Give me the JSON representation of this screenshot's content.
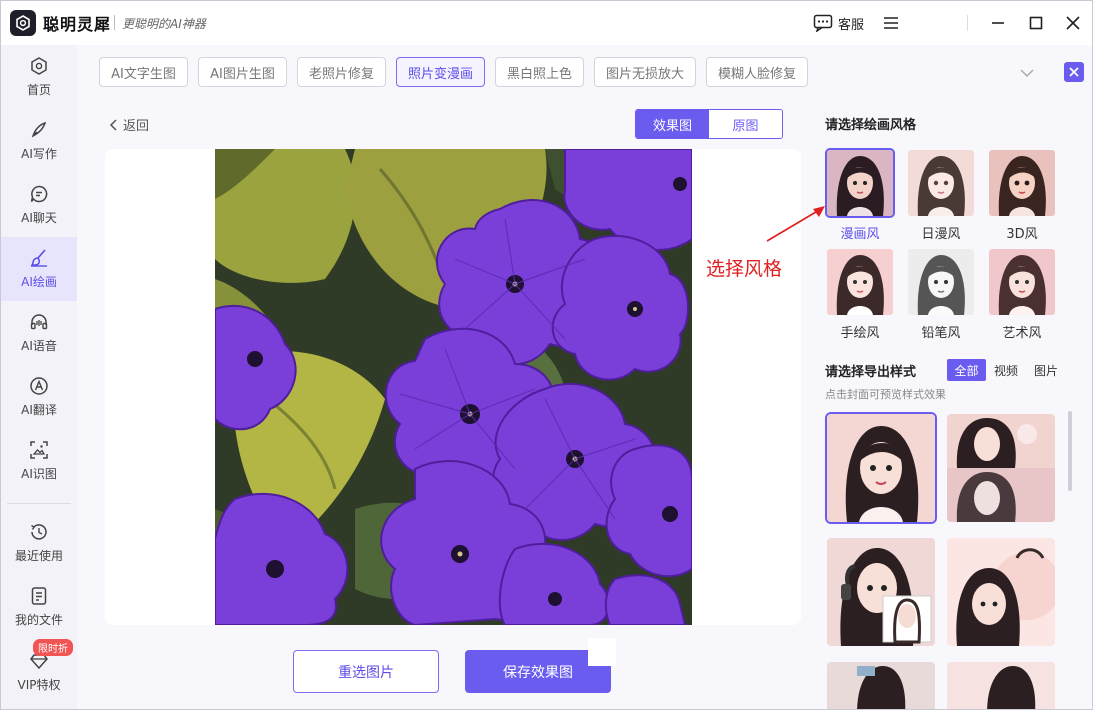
{
  "app": {
    "name": "聪明灵犀",
    "slogan": "更聪明的AI神器",
    "support_label": "客服"
  },
  "sidebar": {
    "items": [
      {
        "label": "首页",
        "icon": "home-icon"
      },
      {
        "label": "AI写作",
        "icon": "pen-icon"
      },
      {
        "label": "AI聊天",
        "icon": "chat-icon"
      },
      {
        "label": "AI绘画",
        "icon": "brush-icon",
        "active": true
      },
      {
        "label": "AI语音",
        "icon": "headphones-icon"
      },
      {
        "label": "AI翻译",
        "icon": "translate-icon"
      },
      {
        "label": "AI识图",
        "icon": "image-scan-icon"
      },
      {
        "label": "最近使用",
        "icon": "history-icon"
      },
      {
        "label": "我的文件",
        "icon": "file-icon"
      },
      {
        "label": "VIP特权",
        "icon": "diamond-icon"
      }
    ],
    "vip_badge": "限时折"
  },
  "tabs": [
    {
      "label": "AI文字生图"
    },
    {
      "label": "AI图片生图"
    },
    {
      "label": "老照片修复"
    },
    {
      "label": "照片变漫画",
      "active": true
    },
    {
      "label": "黑白照上色"
    },
    {
      "label": "图片无损放大"
    },
    {
      "label": "模糊人脸修复"
    }
  ],
  "main": {
    "back_label": "返回",
    "toggle": {
      "result": "效果图",
      "original": "原图",
      "selected": "效果图"
    },
    "reselect_label": "重选图片",
    "save_label": "保存效果图"
  },
  "panel": {
    "style_title": "请选择绘画风格",
    "styles": [
      {
        "name": "漫画风",
        "selected": true
      },
      {
        "name": "日漫风"
      },
      {
        "name": "3D风"
      },
      {
        "name": "手绘风"
      },
      {
        "name": "铅笔风"
      },
      {
        "name": "艺术风"
      }
    ],
    "export_title": "请选择导出样式",
    "filters": [
      {
        "label": "全部",
        "active": true
      },
      {
        "label": "视频"
      },
      {
        "label": "图片"
      }
    ],
    "hint": "点击封面可预览样式效果"
  },
  "annotation": {
    "text": "选择风格",
    "color": "#e02020"
  },
  "colors": {
    "accent": "#6b5cf0",
    "sidebar_bg": "#f2f2f8",
    "panel_bg": "#f8f8fc"
  }
}
